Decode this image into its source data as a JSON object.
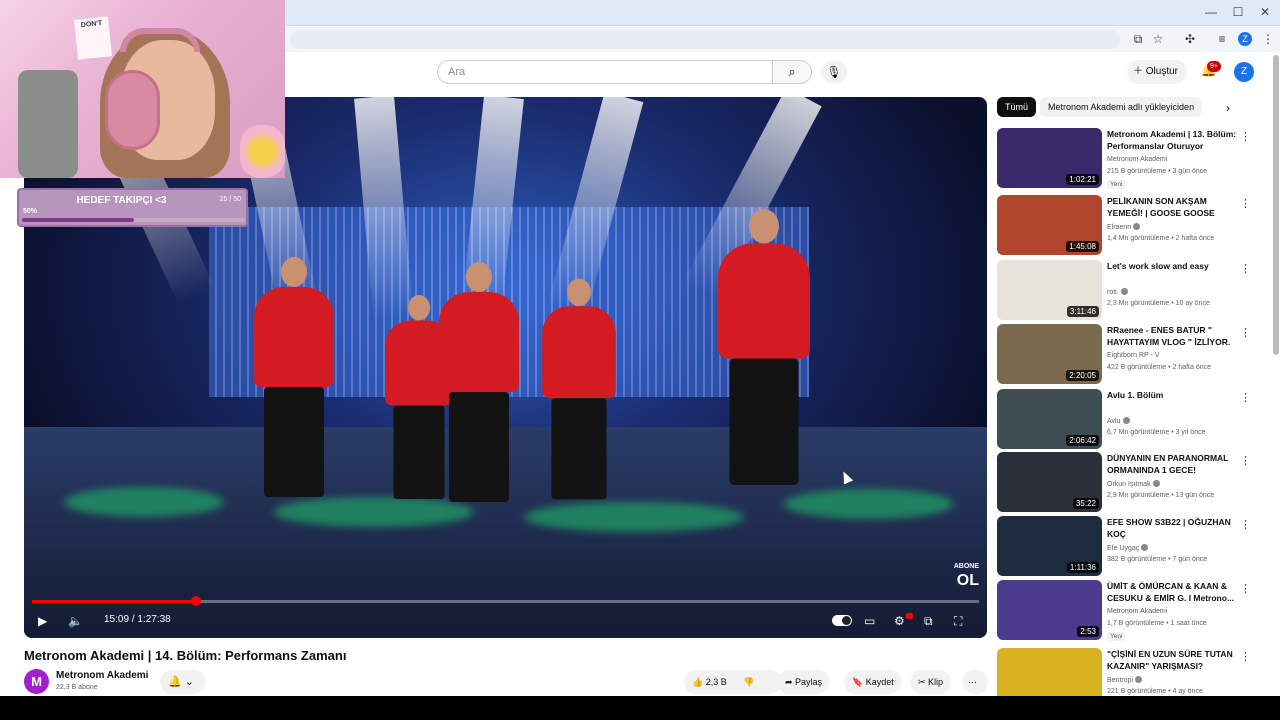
{
  "browser": {
    "minimize_icon": "—",
    "maximize_icon": "☐",
    "close_icon": "✕"
  },
  "overlay": {
    "card_text": "DON'T",
    "goal_title": "HEDEF TAKIPÇI <3",
    "goal_count": "25 / 50",
    "goal_percent_label": "50%",
    "goal_progress": 0.5
  },
  "header": {
    "search_placeholder": "Ara",
    "create_label": "Oluştur",
    "notification_badge": "9+",
    "avatar_letter": "Z"
  },
  "player": {
    "current_time": "15:09 / 1:27:38",
    "progress": 0.173,
    "watermark_small": "ABONE",
    "watermark_big": "OL"
  },
  "video": {
    "title": "Metronom Akademi | 14. Bölüm: Performans Zamanı",
    "channel_initial": "M",
    "channel_name": "Metronom Akademi",
    "subscribers": "22,3 B abone",
    "likes": "2,3 B",
    "share_label": "Paylaş",
    "save_label": "Kaydet",
    "clip_label": "Klip",
    "more_icon": "⋯"
  },
  "sidebar": {
    "chips": [
      {
        "label": "Tümü",
        "active": true
      },
      {
        "label": "Metronom Akademi adlı yükleyiciden",
        "active": false
      }
    ],
    "items": [
      {
        "title": "Metronom Akademi | 13. Bölüm: Performanslar Oturuyor",
        "channel": "Metronom Akademi",
        "verified": false,
        "meta": "215 B görüntüleme • 3 gün önce",
        "badge": "Yeni",
        "duration": "1:02:21",
        "thumb_color": "#3a2a6b"
      },
      {
        "title": "PELİKANIN SON AKŞAM YEMEĞİ! | GOOSE GOOSE DUC...",
        "channel": "Elraenn",
        "verified": true,
        "meta": "1,4 Mn görüntüleme • 2 hafta önce",
        "badge": "",
        "duration": "1:45:08",
        "thumb_color": "#b0462b"
      },
      {
        "title": "Let's work slow and easy",
        "channel": "roti.",
        "verified": true,
        "meta": "2,3 Mn görüntüleme • 10 ay önce",
        "badge": "",
        "duration": "3:11:46",
        "thumb_color": "#e8e3da"
      },
      {
        "title": "RRaenee - ENES BATUR \" HAYATTAYIM VLOG \" İZLİYOR.",
        "channel": "Eightborn RP - V",
        "verified": false,
        "meta": "422 B görüntüleme • 2 hafta önce",
        "badge": "",
        "duration": "2:20:05",
        "thumb_color": "#7b6a4e"
      },
      {
        "title": "Avlu 1. Bölüm",
        "channel": "Avlu",
        "verified": true,
        "meta": "6,7 Mn görüntüleme • 3 yıl önce",
        "badge": "",
        "duration": "2:06:42",
        "thumb_color": "#3e4d52"
      },
      {
        "title": "DÜNYANIN EN PARANORMAL ORMANINDA 1 GECE!",
        "channel": "Orkun Işıtmak",
        "verified": true,
        "meta": "2,9 Mn görüntüleme • 13 gün önce",
        "badge": "",
        "duration": "35:22",
        "thumb_color": "#2b2f3a"
      },
      {
        "title": "EFE SHOW S3B22 | OĞUZHAN KOÇ",
        "channel": "Efe Uygaç",
        "verified": true,
        "meta": "382 B görüntüleme • 7 gün önce",
        "badge": "",
        "duration": "1:11:36",
        "thumb_color": "#1d2c3f"
      },
      {
        "title": "ÜMİT & ÖMÜRCAN & KAAN & CESUKU & EMİR G. I Metrono...",
        "channel": "Metronom Akademi",
        "verified": false,
        "meta": "1,7 B görüntüleme • 1 saat önce",
        "badge": "Yeni",
        "duration": "2:53",
        "thumb_color": "#4a3b8f"
      },
      {
        "title": "\"ÇİŞİNİ EN UZUN SÜRE TUTAN KAZANIR\" YARIŞMASI?",
        "channel": "Bentropi",
        "verified": true,
        "meta": "221 B görüntüleme • 4 ay önce",
        "badge": "",
        "duration": "",
        "thumb_color": "#d8b21f"
      }
    ]
  }
}
